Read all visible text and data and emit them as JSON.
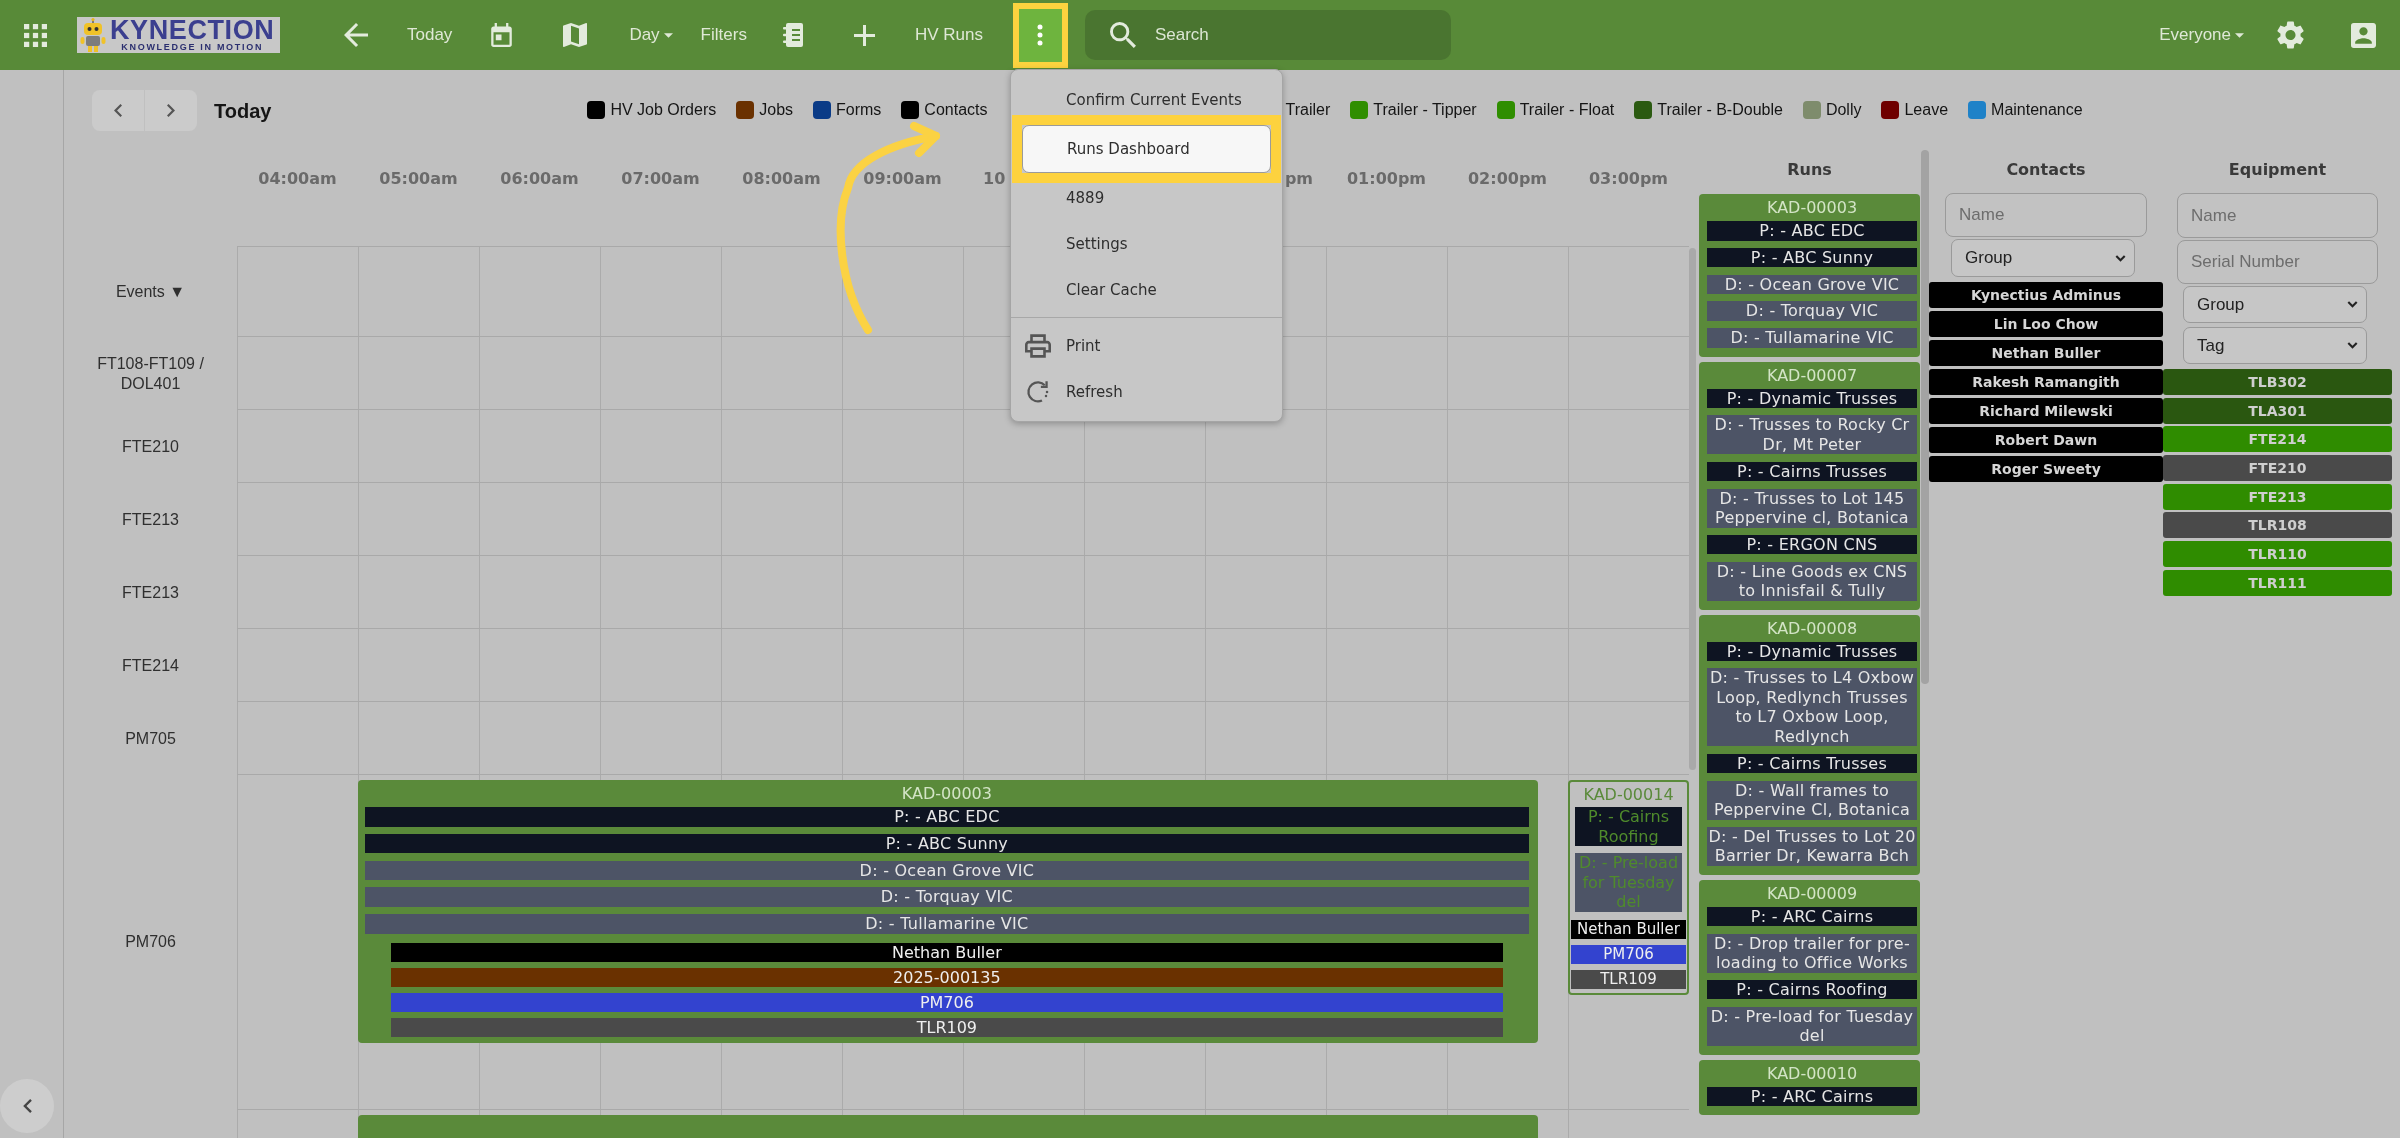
{
  "topbar": {
    "logo": {
      "wordmark": "KYNECTION",
      "tagline": "KNOWLEDGE IN MOTION"
    },
    "today_label": "Today",
    "view_label": "Day",
    "filters_label": "Filters",
    "runs_label": "HV Runs",
    "more_callout": true,
    "search": {
      "placeholder": "Search"
    },
    "user_filter": "Everyone"
  },
  "nav": {
    "title": "Today"
  },
  "legend": [
    {
      "label": "HV Job Orders",
      "color": "#000000"
    },
    {
      "label": "Jobs",
      "color": "#6a3100"
    },
    {
      "label": "Forms",
      "color": "#0a3b87"
    },
    {
      "label": "Contacts",
      "color": "#000000"
    },
    {
      "label": "Trailer"
    },
    {
      "label": "Trailer - Tipper",
      "color": "#2f8e00"
    },
    {
      "label": "Trailer - Float",
      "color": "#2f8e00"
    },
    {
      "label": "Trailer - B-Double",
      "color": "#2b5a11"
    },
    {
      "label": "Dolly",
      "color": "#7e8c6c"
    },
    {
      "label": "Leave",
      "color": "#6e0000"
    },
    {
      "label": "Maintenance",
      "color": "#1f82c8"
    }
  ],
  "menu": {
    "sections": [
      {
        "items": [
          {
            "label": "Confirm Current Events",
            "selected": false,
            "callout": false
          },
          {
            "label": "Runs Dashboard",
            "selected": true,
            "callout": true
          },
          {
            "label": "4889",
            "selected": false,
            "callout": false
          },
          {
            "label": "Settings",
            "selected": false,
            "callout": false
          },
          {
            "label": "Clear Cache",
            "selected": false,
            "callout": false
          }
        ]
      },
      {
        "items": [
          {
            "label": "Print",
            "selected": false,
            "callout": false
          },
          {
            "label": "Refresh",
            "selected": false,
            "callout": false
          }
        ]
      }
    ]
  },
  "schedule": {
    "time_columns": [
      "04:00am",
      "05:00am",
      "06:00am",
      "07:00am",
      "08:00am",
      "09:00am",
      "10",
      "pm",
      "01:00pm",
      "02:00pm",
      "03:00pm"
    ],
    "rows": [
      {
        "label": "Events ▼"
      },
      {
        "label": "FT108-FT109 / DOL401"
      },
      {
        "label": "FTE210"
      },
      {
        "label": "FTE213"
      },
      {
        "label": "FTE213"
      },
      {
        "label": "FTE214"
      },
      {
        "label": "PM705"
      },
      {
        "label": "PM706",
        "events": [
          {
            "title": "KAD-00003",
            "confirmed": true,
            "stops": [
              {
                "kind": "pickup",
                "text": "P: - ABC EDC"
              },
              {
                "kind": "pickup",
                "text": "P: - ABC Sunny"
              },
              {
                "kind": "delivery",
                "text": "D: - Ocean Grove VIC"
              },
              {
                "kind": "delivery",
                "text": "D: - Torquay VIC"
              },
              {
                "kind": "delivery",
                "text": "D: - Tullamarine VIC"
              }
            ],
            "resources": [
              {
                "label": "Nethan Buller",
                "color": "#000000"
              },
              {
                "label": "2025-000135",
                "color": "#6a3100"
              },
              {
                "label": "PM706",
                "color": "#3343cf"
              },
              {
                "label": "TLR109",
                "color": "#4a4a4a"
              }
            ]
          },
          {
            "title": "KAD-00014",
            "confirmed": false,
            "stops": [
              {
                "kind": "pickup",
                "text": "P: - Cairns Roofing"
              },
              {
                "kind": "delivery",
                "text": "D: - Pre-load for Tuesday del"
              }
            ],
            "resources": [
              {
                "label": "Nethan Buller",
                "color": "#000000"
              },
              {
                "label": "PM706",
                "color": "#3343cf"
              },
              {
                "label": "TLR109",
                "color": "#4a4a4a"
              }
            ]
          }
        ]
      },
      {
        "events": [
          {
            "confirmed": true
          }
        ]
      }
    ]
  },
  "runs": {
    "title": "Runs",
    "cards": [
      {
        "title": "KAD-00003",
        "stops": [
          {
            "kind": "pickup",
            "text": "P: - ABC EDC"
          },
          {
            "kind": "pickup",
            "text": "P: - ABC Sunny"
          },
          {
            "kind": "delivery",
            "text": "D: - Ocean Grove VIC"
          },
          {
            "kind": "delivery",
            "text": "D: - Torquay VIC"
          },
          {
            "kind": "delivery",
            "text": "D: - Tullamarine VIC"
          }
        ]
      },
      {
        "title": "KAD-00007",
        "stops": [
          {
            "kind": "pickup",
            "text": "P: - Dynamic Trusses"
          },
          {
            "kind": "delivery",
            "text": "D: - Trusses to Rocky Cr Dr, Mt Peter"
          },
          {
            "kind": "pickup",
            "text": "P: - Cairns Trusses"
          },
          {
            "kind": "delivery",
            "text": "D: - Trusses to Lot 145 Peppervine cl, Botanica"
          },
          {
            "kind": "pickup",
            "text": "P: - ERGON CNS"
          },
          {
            "kind": "delivery",
            "text": "D: - Line Goods ex CNS to Innisfail & Tully"
          }
        ]
      },
      {
        "title": "KAD-00008",
        "stops": [
          {
            "kind": "pickup",
            "text": "P: - Dynamic Trusses"
          },
          {
            "kind": "delivery",
            "text": "D: - Trusses to L4 Oxbow Loop, Redlynch Trusses to L7 Oxbow Loop, Redlynch"
          },
          {
            "kind": "pickup",
            "text": "P: - Cairns Trusses"
          },
          {
            "kind": "delivery",
            "text": "D: - Wall frames to Peppervine Cl, Botanica"
          },
          {
            "kind": "delivery",
            "text": "D: - Del Trusses to Lot 20 Barrier Dr, Kewarra Bch"
          }
        ]
      },
      {
        "title": "KAD-00009",
        "stops": [
          {
            "kind": "pickup",
            "text": "P: - ARC Cairns"
          },
          {
            "kind": "delivery",
            "text": "D: - Drop trailer for pre-loading to Office Works"
          },
          {
            "kind": "pickup",
            "text": "P: - Cairns Roofing"
          },
          {
            "kind": "delivery",
            "text": "D: - Pre-load for Tuesday del"
          }
        ]
      },
      {
        "title": "KAD-00010",
        "stops": [
          {
            "kind": "pickup",
            "text": "P: - ARC Cairns"
          }
        ]
      }
    ]
  },
  "contacts": {
    "title": "Contacts",
    "name_field": {
      "placeholder": "Name"
    },
    "group_select": "Group",
    "items": [
      "Kynectius Adminus",
      "Lin Loo Chow",
      "Nethan Buller",
      "Rakesh Ramangith",
      "Richard Milewski",
      "Robert Dawn",
      "Roger Sweety"
    ]
  },
  "equipment": {
    "title": "Equipment",
    "name_field": {
      "placeholder": "Name"
    },
    "serial_field": {
      "placeholder": "Serial Number"
    },
    "group_select": "Group",
    "tag_select": "Tag",
    "items": [
      {
        "label": "TLB302",
        "color": "#2a5710"
      },
      {
        "label": "TLA301",
        "color": "#2a5710"
      },
      {
        "label": "FTE214",
        "color": "#2f8c00"
      },
      {
        "label": "FTE210",
        "color": "#4a4a4a"
      },
      {
        "label": "FTE213",
        "color": "#2f8c00"
      },
      {
        "label": "TLR108",
        "color": "#4a4a4a"
      },
      {
        "label": "TLR110",
        "color": "#2f8c00"
      },
      {
        "label": "TLR111",
        "color": "#2f8c00"
      }
    ]
  }
}
